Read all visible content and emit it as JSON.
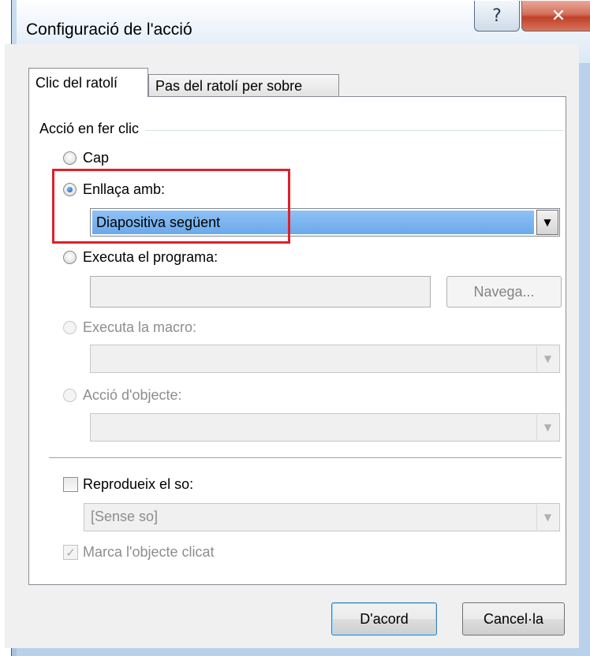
{
  "window": {
    "title": "Configuració de l'acció",
    "help_button": "?",
    "close_button": "✕"
  },
  "tabs": [
    {
      "label": "Clic del ratolí",
      "active": true
    },
    {
      "label": "Pas del ratolí per sobre",
      "active": false
    }
  ],
  "group": {
    "label": "Acció en fer clic"
  },
  "options": {
    "none": {
      "label": "Cap",
      "checked": false
    },
    "link": {
      "label": "Enllaça amb:",
      "checked": true
    },
    "link_value": "Diapositiva següent",
    "run_program": {
      "label": "Executa el programa:",
      "checked": false
    },
    "browse_button": "Navega...",
    "run_macro": {
      "label": "Executa la macro:",
      "enabled": false
    },
    "object_action": {
      "label": "Acció d'objecte:",
      "enabled": false
    }
  },
  "sound": {
    "label": "Reprodueix el so:",
    "checked": false,
    "value": "[Sense so]"
  },
  "highlight_click": {
    "label": "Marca l'objecte clicat",
    "checked": true,
    "enabled": false
  },
  "buttons": {
    "ok": "D'acord",
    "cancel": "Cancel·la"
  },
  "colors": {
    "annotation_box": "#e0202a",
    "selection": "#6aa9ea"
  }
}
